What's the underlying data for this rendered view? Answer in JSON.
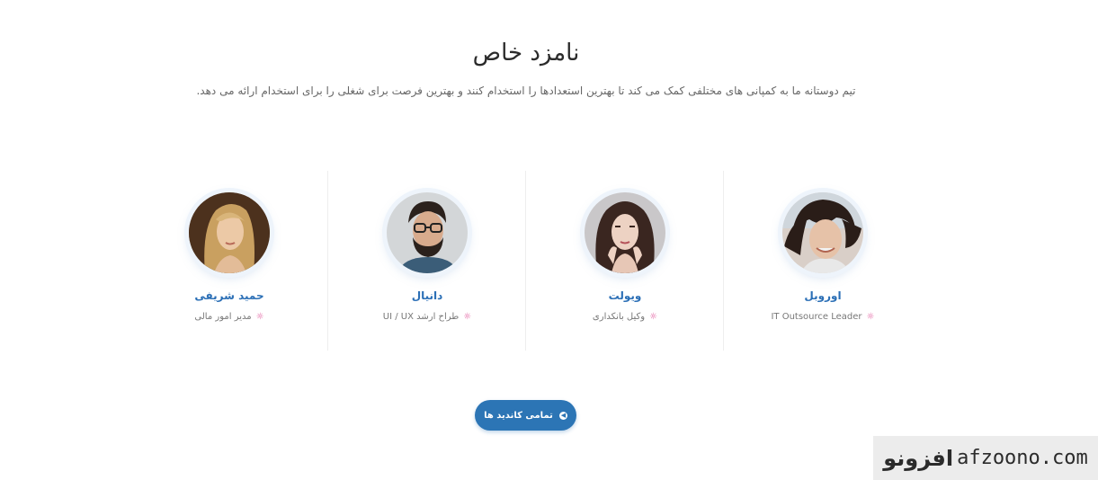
{
  "section": {
    "title": "نامزد خاص",
    "subtitle": "تیم دوستانه ما به کمپانی های مختلفی کمک می کند تا بهترین استعدادها را استخدام کنند و بهترین فرصت برای شغلی را برای استخدام ارائه می دهد."
  },
  "candidates": [
    {
      "name": "اوروبل",
      "role": "IT Outsource Leader",
      "avatar": "person-photo"
    },
    {
      "name": "ویولت",
      "role": "وکیل بانکداری",
      "avatar": "person-photo"
    },
    {
      "name": "دانیال",
      "role": "طراح ارشد UI / UX",
      "avatar": "person-photo"
    },
    {
      "name": "حمید شریفی",
      "role": "مدیر امور مالی",
      "avatar": "person-photo"
    }
  ],
  "role_icon": "bulb-icon",
  "all_button": {
    "label": "تمامی کاندید ها",
    "icon": "arrow-circle-icon"
  },
  "watermark": {
    "fa": "افزونو",
    "en": "afzoono.com"
  },
  "colors": {
    "accent": "#2c75b5",
    "name": "#2b6fb6",
    "role_icon": "#e0559a",
    "watermark_accent": "#f08a1a"
  }
}
